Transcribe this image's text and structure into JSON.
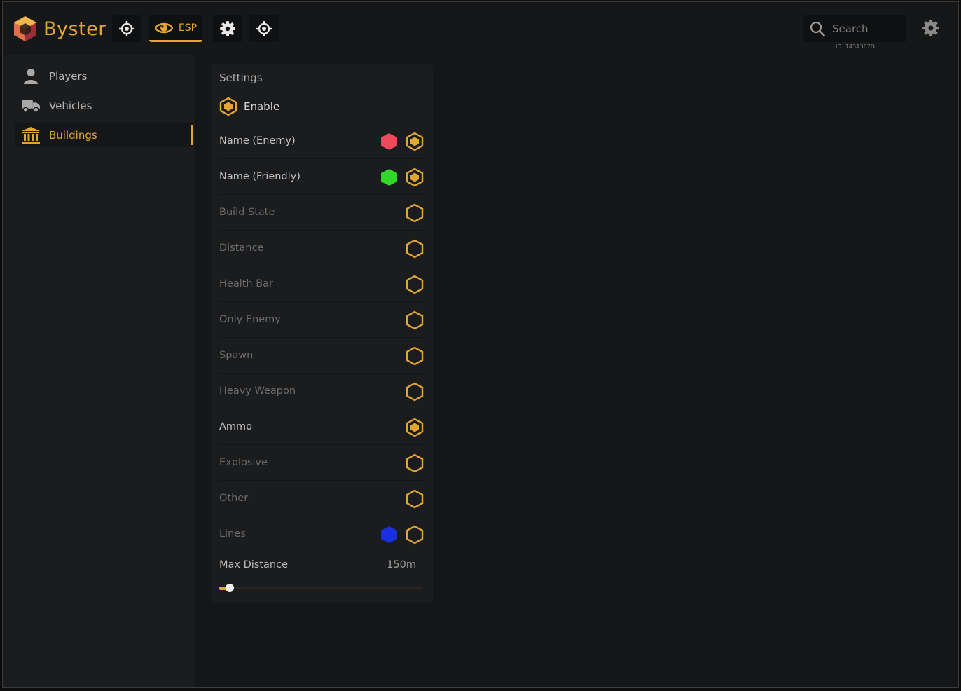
{
  "app": {
    "name": "Byster"
  },
  "colors": {
    "accent": "#e3a633",
    "enemy": "#e94b5a",
    "friendly": "#33d62a",
    "lines": "#1a2fe0"
  },
  "topnav": {
    "items": [
      {
        "icon": "crosshair-icon"
      },
      {
        "icon": "eye-icon",
        "label": "ESP",
        "active": true
      },
      {
        "icon": "gear-icon"
      },
      {
        "icon": "crosshair-icon"
      }
    ]
  },
  "search": {
    "placeholder": "Search",
    "user_id": "ID: 143A3E7D"
  },
  "sidebar": {
    "items": [
      {
        "label": "Players",
        "icon": "user-icon",
        "active": false
      },
      {
        "label": "Vehicles",
        "icon": "truck-icon",
        "active": false
      },
      {
        "label": "Buildings",
        "icon": "building-icon",
        "active": true
      }
    ]
  },
  "settings": {
    "title": "Settings",
    "enable": {
      "label": "Enable",
      "checked": true
    },
    "options": [
      {
        "label": "Name (Enemy)",
        "checked": true,
        "color": "#e94b5a",
        "color_name": "red"
      },
      {
        "label": "Name (Friendly)",
        "checked": true,
        "color": "#33d62a",
        "color_name": "green"
      },
      {
        "label": "Build State",
        "checked": false
      },
      {
        "label": "Distance",
        "checked": false
      },
      {
        "label": "Health Bar",
        "checked": false
      },
      {
        "label": "Only Enemy",
        "checked": false
      },
      {
        "label": "Spawn",
        "checked": false
      },
      {
        "label": "Heavy Weapon",
        "checked": false
      },
      {
        "label": "Ammo",
        "checked": true
      },
      {
        "label": "Explosive",
        "checked": false
      },
      {
        "label": "Other",
        "checked": false
      },
      {
        "label": "Lines",
        "checked": false,
        "color": "#1a2fe0",
        "color_name": "blue"
      }
    ],
    "max_distance": {
      "label": "Max Distance",
      "value": "150m",
      "slider_fraction": 0.05
    }
  }
}
